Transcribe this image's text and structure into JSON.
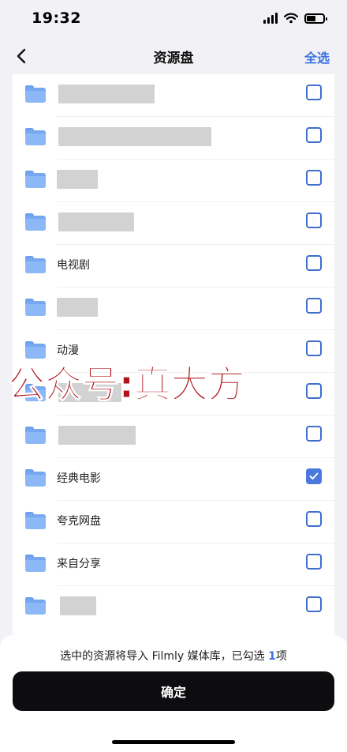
{
  "status_bar": {
    "time": "19:32"
  },
  "nav": {
    "title": "资源盘",
    "select_all_label": "全选"
  },
  "list": {
    "rows": [
      {
        "name": "",
        "blurred": true,
        "checked": false
      },
      {
        "name": "",
        "blurred": true,
        "checked": false
      },
      {
        "name": "",
        "blurred": true,
        "checked": false
      },
      {
        "name": "",
        "blurred": true,
        "checked": false
      },
      {
        "name": "电视剧",
        "blurred": false,
        "checked": false
      },
      {
        "name": "",
        "blurred": true,
        "checked": false
      },
      {
        "name": "动漫",
        "blurred": false,
        "checked": false
      },
      {
        "name": "",
        "blurred": true,
        "checked": false
      },
      {
        "name": "",
        "blurred": true,
        "checked": false
      },
      {
        "name": "经典电影",
        "blurred": false,
        "checked": true
      },
      {
        "name": "夸克网盘",
        "blurred": false,
        "checked": false
      },
      {
        "name": "来自分享",
        "blurred": false,
        "checked": false
      },
      {
        "name": "",
        "blurred": true,
        "checked": false
      }
    ]
  },
  "watermark": {
    "text": "公众号:真大方"
  },
  "footer": {
    "hint_prefix": "选中的资源将导入 Filmly 媒体库，已勾选 ",
    "selected_count": "1",
    "hint_suffix": "项",
    "confirm_label": "确定"
  },
  "colors": {
    "accent": "#3a6fe0",
    "watermark": "#b0141a",
    "button": "#0d0d0f"
  }
}
